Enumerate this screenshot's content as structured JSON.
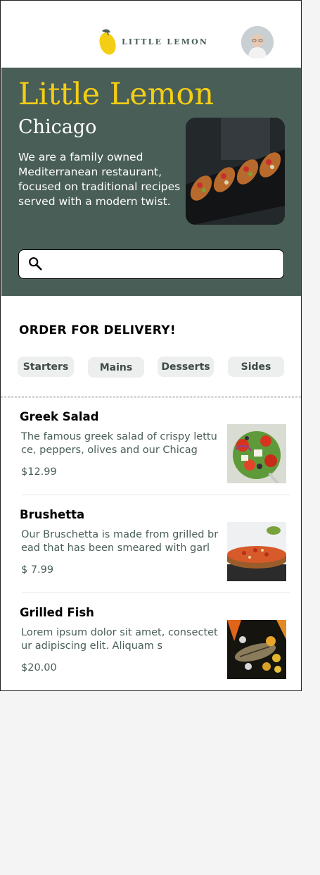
{
  "header": {
    "logo_text": "LITTLE LEMON"
  },
  "hero": {
    "title": "Little Lemon",
    "city": "Chicago",
    "description": "We are a family owned Mediterranean restaurant, focused on traditional recipes served with a modern twist.",
    "search_placeholder": ""
  },
  "order": {
    "title": "ORDER FOR DELIVERY!",
    "categories": [
      "Starters",
      "Mains",
      "Desserts",
      "Sides"
    ]
  },
  "menu": [
    {
      "name": "Greek Salad",
      "description": "The famous greek salad of crispy lettuce, peppers, olives and our Chicag",
      "price": "$12.99"
    },
    {
      "name": "Brushetta",
      "description": "Our Bruschetta is made from grilled bread that has been smeared with garl",
      "price": "$ 7.99"
    },
    {
      "name": "Grilled Fish",
      "description": "Lorem ipsum dolor sit amet, consectetur adipiscing elit. Aliquam s",
      "price": "$20.00"
    }
  ],
  "colors": {
    "primary_green": "#495e57",
    "primary_yellow": "#f4ce14",
    "chip_bg": "#edefee"
  }
}
